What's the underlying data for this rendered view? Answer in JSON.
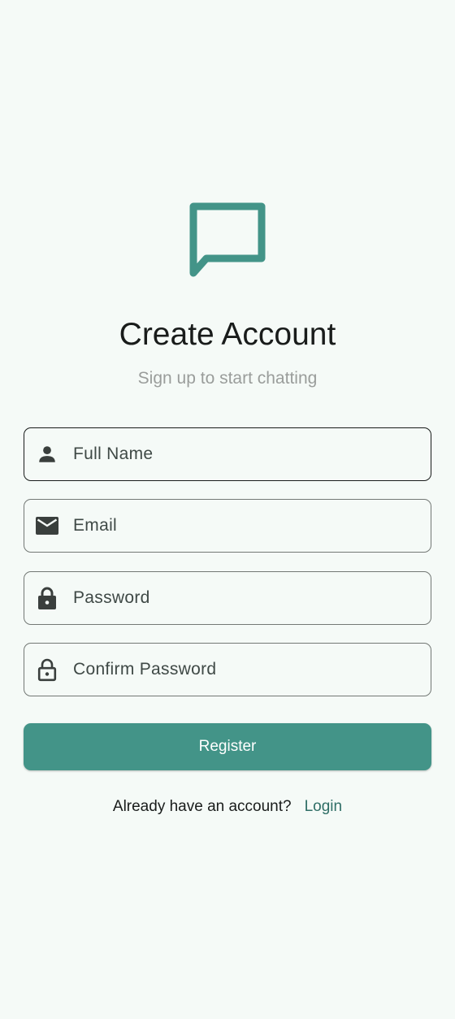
{
  "app": {
    "logo_icon": "chat-bubble-icon",
    "accent_color": "#439488"
  },
  "header": {
    "title": "Create Account",
    "subtitle": "Sign up to start chatting"
  },
  "form": {
    "full_name": {
      "placeholder": "Full Name",
      "icon": "person-icon",
      "value": ""
    },
    "email": {
      "placeholder": "Email",
      "icon": "mail-icon",
      "value": ""
    },
    "password": {
      "placeholder": "Password",
      "icon": "lock-icon",
      "value": ""
    },
    "confirm_password": {
      "placeholder": "Confirm Password",
      "icon": "lock-open-outline-icon",
      "value": ""
    }
  },
  "actions": {
    "register_label": "Register"
  },
  "footer": {
    "prompt": "Already have an account?",
    "login_label": "Login"
  }
}
